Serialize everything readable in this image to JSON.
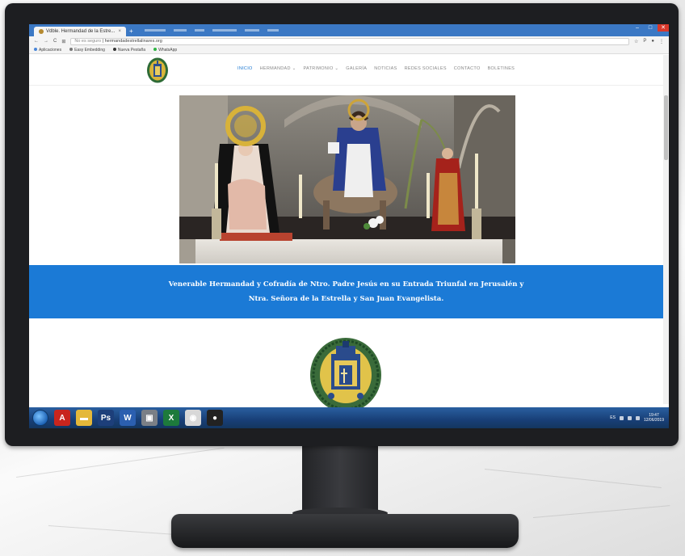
{
  "browser": {
    "tab_title": "Vdble. Hermandad de la Estre...",
    "tab_close": "×",
    "new_tab": "+",
    "url_secure_label": "No es seguro",
    "url": "hermandadestrellalinares.org",
    "nav_back": "←",
    "nav_forward": "→",
    "nav_reload": "C",
    "star_icon": "☆",
    "menu_icon": "⋮",
    "bookmarks": [
      {
        "label": "Aplicaciones",
        "color": "#4a86d8"
      },
      {
        "label": "Easy Embedding",
        "color": "#777777"
      },
      {
        "label": "Nueva Pestaña",
        "color": "#333333"
      },
      {
        "label": "WhatsApp",
        "color": "#2fb344"
      }
    ]
  },
  "site": {
    "nav": [
      {
        "label": "INICIO",
        "active": true
      },
      {
        "label": "HERMANDAD ⌄",
        "active": false
      },
      {
        "label": "PATRIMONIO ⌄",
        "active": false
      },
      {
        "label": "GALERÍA",
        "active": false
      },
      {
        "label": "NOTICIAS",
        "active": false
      },
      {
        "label": "REDES SOCIALES",
        "active": false
      },
      {
        "label": "CONTACTO",
        "active": false
      },
      {
        "label": "BOLETINES",
        "active": false
      }
    ],
    "banner_line1": "Venerable Hermandad y Cofradía de Ntro. Padre Jesús en su Entrada Triunfal en Jerusalén y",
    "banner_line2": "Ntra. Señora de la Estrella y San Juan Evangelista.",
    "accent": "#1b7ad6"
  },
  "taskbar": {
    "icons": [
      {
        "name": "start-orb",
        "color": "#1e63b6"
      },
      {
        "name": "acrobat-icon",
        "color": "#c8251d",
        "glyph": "A"
      },
      {
        "name": "explorer-folder-icon",
        "color": "#e4b83a",
        "glyph": "▬"
      },
      {
        "name": "photoshop-icon",
        "color": "#1d3f7a",
        "glyph": "Ps"
      },
      {
        "name": "word-icon",
        "color": "#2b5fb0",
        "glyph": "W"
      },
      {
        "name": "media-icon",
        "color": "#7a7f86",
        "glyph": "▣"
      },
      {
        "name": "excel-icon",
        "color": "#1d7a3c",
        "glyph": "X"
      },
      {
        "name": "chrome-icon",
        "color": "#d8d8d8",
        "glyph": "◉"
      },
      {
        "name": "obs-icon",
        "color": "#222222",
        "glyph": "●"
      }
    ],
    "tray_lang": "ES",
    "time": "19:47",
    "date": "12/06/2019"
  }
}
